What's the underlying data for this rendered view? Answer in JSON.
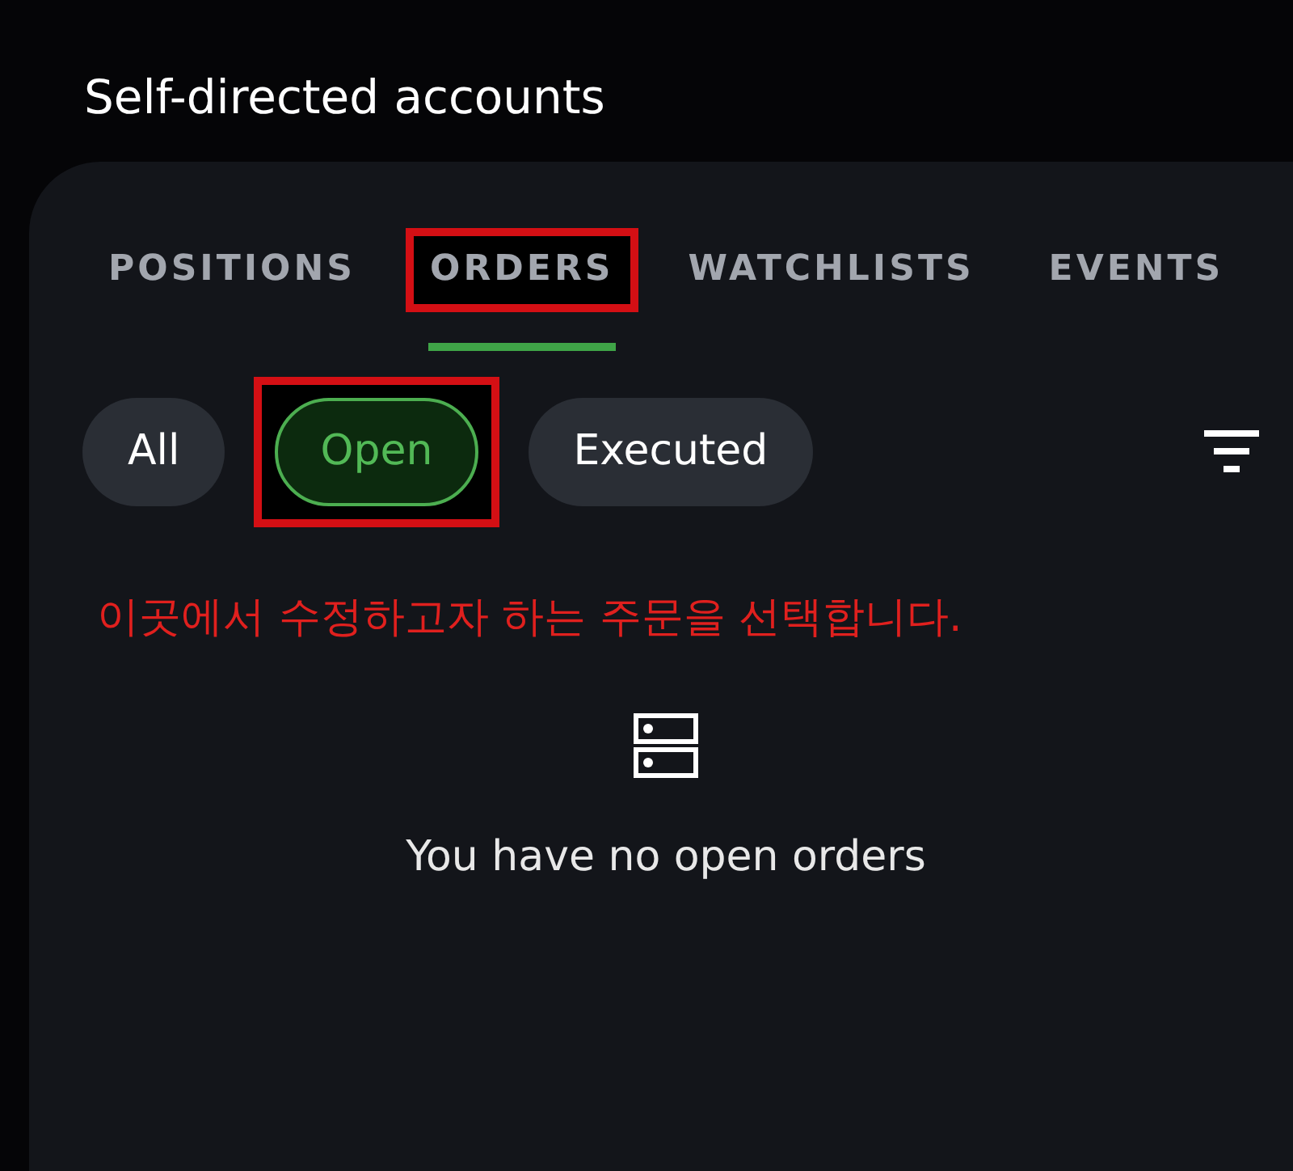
{
  "header": {
    "title": "Self-directed accounts"
  },
  "tabs": [
    {
      "label": "POSITIONS",
      "selected": false,
      "highlighted": false
    },
    {
      "label": "ORDERS",
      "selected": true,
      "highlighted": true
    },
    {
      "label": "WATCHLISTS",
      "selected": false,
      "highlighted": false
    },
    {
      "label": "EVENTS",
      "selected": false,
      "highlighted": false
    }
  ],
  "filters": [
    {
      "label": "All",
      "selected": false,
      "highlighted": false
    },
    {
      "label": "Open",
      "selected": true,
      "highlighted": true
    },
    {
      "label": "Executed",
      "selected": false,
      "highlighted": false
    }
  ],
  "annotation": "이곳에서 수정하고자 하는 주문을 선택합니다.",
  "empty_state": {
    "message": "You have no open orders"
  }
}
